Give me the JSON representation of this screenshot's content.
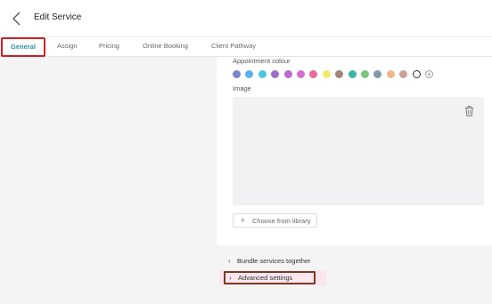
{
  "header": {
    "title": "Edit Service",
    "back_icon": "chevron-left-icon"
  },
  "tabs": [
    {
      "label": "General",
      "active": true
    },
    {
      "label": "Assign"
    },
    {
      "label": "Pricing"
    },
    {
      "label": "Online Booking"
    },
    {
      "label": "Client Pathway"
    }
  ],
  "appointment_colour": {
    "label": "Appointment colour",
    "colours": [
      "#7a86c9",
      "#5ab0e8",
      "#4dc6d9",
      "#9a72c4",
      "#bb6bc9",
      "#d26fcf",
      "#e8699b",
      "#f2e96a",
      "#a08676",
      "#3fb3a3",
      "#7cc47c",
      "#8399a8",
      "#f0b58a",
      "#c9a09a"
    ],
    "selected": "#ffffff",
    "add_icon": "plus-circle-icon"
  },
  "image": {
    "label": "Image",
    "delete_icon": "trash-icon"
  },
  "choose_from_library": {
    "label": "Choose from library",
    "icon": "plus-icon"
  },
  "bundle": {
    "label": "Bundle services together"
  },
  "advanced": {
    "label": "Advanced settings"
  }
}
